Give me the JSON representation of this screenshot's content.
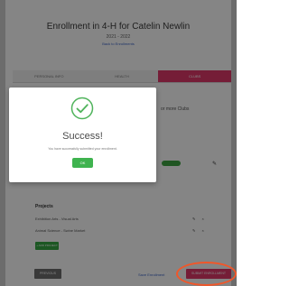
{
  "enrollment": {
    "title": "Enrollment in 4-H for Catelin Newlin",
    "year": "2021 - 2022",
    "link": "Back to Enrollments"
  },
  "tabs": [
    {
      "label": "PERSONAL INFO"
    },
    {
      "label": "HEALTH"
    },
    {
      "label": "CLUBS",
      "active": true
    }
  ],
  "clubs": {
    "text": "or more Clubs"
  },
  "projects": {
    "title": "Projects",
    "rows": [
      {
        "label": "Exhibition Arts - Visual Arts"
      },
      {
        "label": "Animal Science - Swine Market"
      }
    ],
    "add_label": "+ ADD PROJECT",
    "edit_icon": "✎",
    "remove_icon": "×"
  },
  "footer": {
    "previous_label": "PREVIOUS",
    "save_label": "Save Enrollment",
    "submit_label": "SUBMIT ENROLLMENT"
  },
  "modal": {
    "title": "Success!",
    "message": "You have successfully submitted your enrollment.",
    "ok_label": "OK",
    "icon": "check-circle-icon"
  },
  "colors": {
    "accent": "#e0386a",
    "success": "#3fb34f",
    "link": "#3f66c8",
    "highlight": "#f0572a"
  }
}
